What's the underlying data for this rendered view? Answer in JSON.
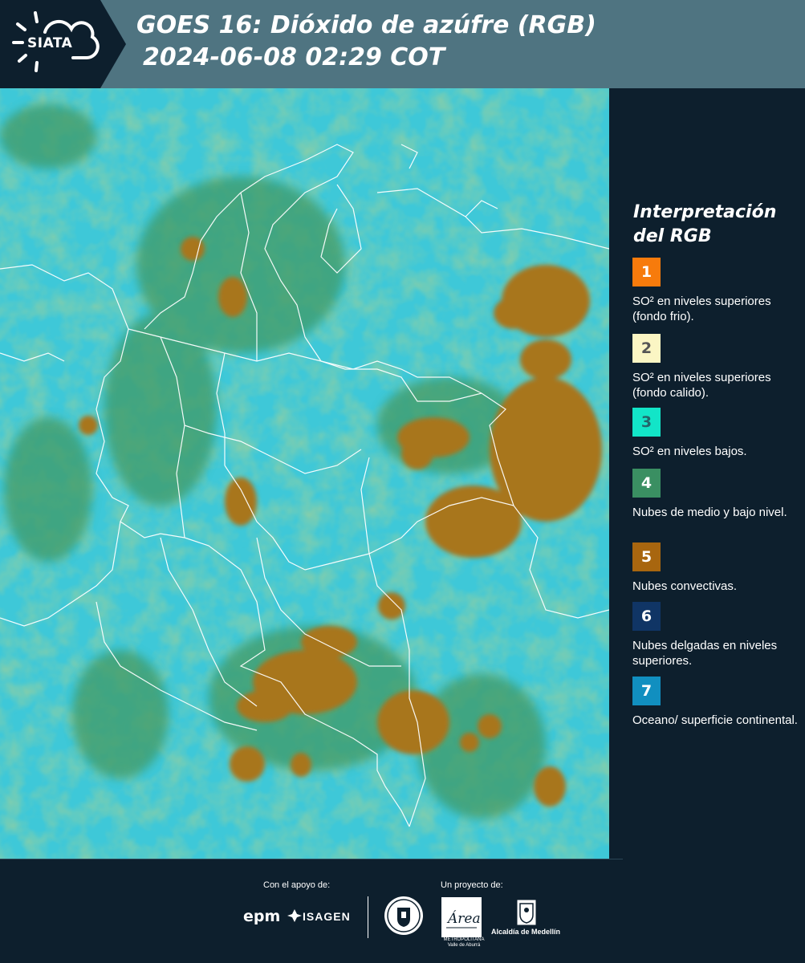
{
  "header": {
    "logo_text": "SIATA",
    "title_line1": "GOES 16: Dióxido de azúfre (RGB)",
    "title_line2": "2024-06-08 02:29 COT"
  },
  "legend": {
    "title_line1": "Interpretación",
    "title_line2": "del RGB",
    "items": [
      {
        "number": "1",
        "label": "SO² en niveles superiores (fondo frio).",
        "color": "#f77b0c",
        "text_color": "#ffffff"
      },
      {
        "number": "2",
        "label": "SO² en niveles superiores (fondo calido).",
        "color": "#fbf6c4",
        "text_color": "#555555"
      },
      {
        "number": "3",
        "label": "SO² en niveles bajos.",
        "color": "#12e5c8",
        "text_color": "#24666a"
      },
      {
        "number": "4",
        "label": "Nubes de medio y bajo nivel.",
        "color": "#3a8f62",
        "text_color": "#ffffff"
      },
      {
        "number": "5",
        "label": "Nubes convectivas.",
        "color": "#a8660f",
        "text_color": "#ffffff"
      },
      {
        "number": "6",
        "label": "Nubes delgadas en niveles superiores.",
        "color": "#103565",
        "text_color": "#ffffff"
      },
      {
        "number": "7",
        "label": "Oceano/ superficie continental.",
        "color": "#118fc0",
        "text_color": "#ffffff"
      }
    ]
  },
  "footer": {
    "support_label": "Con el apoyo de:",
    "project_label": "Un proyecto de:",
    "sponsors": [
      "epm",
      "ISAGEN"
    ],
    "area_logo_text": "Área",
    "area_subtext_line1": "METROPOLITANA",
    "area_subtext_line2": "Valle de Aburrá",
    "alcaldia_label": "Alcaldía de Medellín"
  },
  "map": {
    "background_color": "#3cc9d6",
    "land_cloud_color": "#3f9c6a",
    "convective_color": "#a8761f",
    "border_color": "#ffffff"
  }
}
